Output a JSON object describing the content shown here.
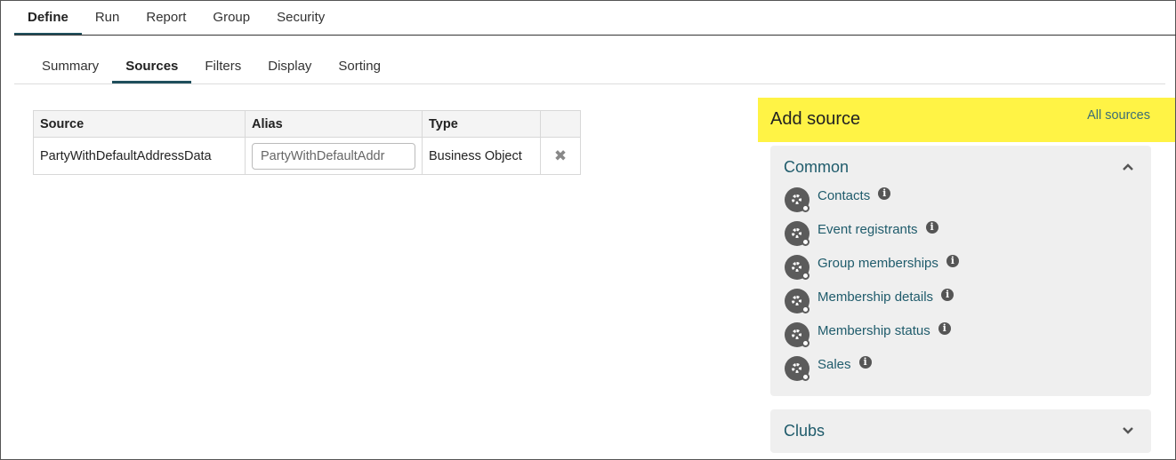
{
  "top_tabs": [
    {
      "label": "Define",
      "active": true
    },
    {
      "label": "Run",
      "active": false
    },
    {
      "label": "Report",
      "active": false
    },
    {
      "label": "Group",
      "active": false
    },
    {
      "label": "Security",
      "active": false
    }
  ],
  "sub_tabs": [
    {
      "label": "Summary",
      "active": false
    },
    {
      "label": "Sources",
      "active": true
    },
    {
      "label": "Filters",
      "active": false
    },
    {
      "label": "Display",
      "active": false
    },
    {
      "label": "Sorting",
      "active": false
    }
  ],
  "table": {
    "headers": [
      "Source",
      "Alias",
      "Type"
    ],
    "rows": [
      {
        "source": "PartyWithDefaultAddressData",
        "alias": "PartyWithDefaultAddr",
        "type": "Business Object",
        "remove_icon": "close-x-icon"
      }
    ]
  },
  "add_source": {
    "title": "Add source",
    "all_sources_link": "All sources",
    "highlight_color": "#fff345",
    "common": {
      "title": "Common",
      "expanded": true,
      "items": [
        {
          "label": "Contacts",
          "icon": "gear-object-icon"
        },
        {
          "label": "Event registrants",
          "icon": "gear-object-icon"
        },
        {
          "label": "Group memberships",
          "icon": "gear-object-icon"
        },
        {
          "label": "Membership details",
          "icon": "gear-object-icon"
        },
        {
          "label": "Membership status",
          "icon": "gear-object-icon"
        },
        {
          "label": "Sales",
          "icon": "gear-object-icon"
        }
      ]
    },
    "clubs": {
      "title": "Clubs",
      "expanded": false
    }
  }
}
